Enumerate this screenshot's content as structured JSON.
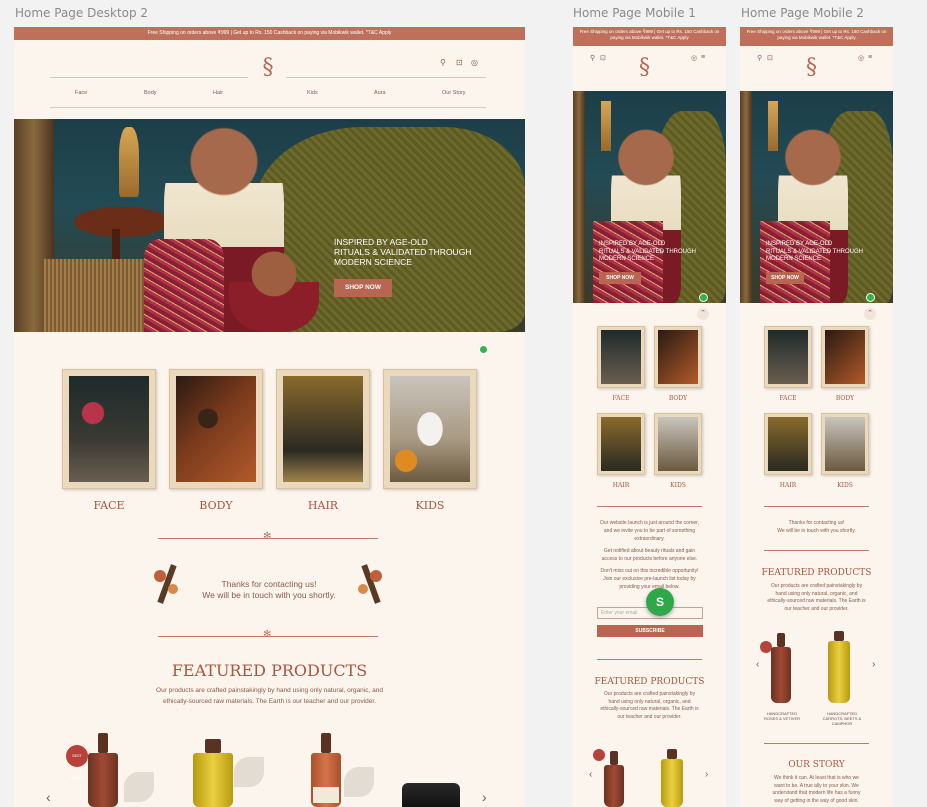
{
  "labels": {
    "desktop": "Home Page Desktop 2",
    "mobile1": "Home Page Mobile 1",
    "mobile2": "Home Page Mobile 2"
  },
  "promo": {
    "desktop": "Free Shipping on orders above ₹999 | Get up to Rs. 150 Cashback on paying via Mobikwik wallet. *T&C Apply",
    "mobile": "Free Shipping on orders above ₹999 | Get up to Rs. 150 Cashback on paying via Mobikwik wallet. *T&C Apply"
  },
  "nav": [
    "Face",
    "Body",
    "Hair",
    "Kids",
    "Aura",
    "Our Story"
  ],
  "hero": {
    "headline_line1": "INSPIRED BY AGE-OLD",
    "headline_line2": "RITUALS & VALIDATED THROUGH",
    "headline_line3": "MODERN SCIENCE",
    "cta": "SHOP NOW"
  },
  "categories": [
    "FACE",
    "BODY",
    "HAIR",
    "KIDS"
  ],
  "thanks": {
    "line1": "Thanks for contacting us!",
    "line2": "We will be in touch with you shortly.",
    "mobile_line1": "Thanks for contacting us!",
    "mobile_line2": "We will be in touch with you shortly."
  },
  "featured": {
    "title": "FEATURED PRODUCTS",
    "desc_line1": "Our products are crafted painstakingly by hand using only natural, organic, and",
    "desc_line2": "ethically-sourced raw materials. The Earth is our teacher and our provider.",
    "mobile_desc1": "Our products are crafted painstakingly by",
    "mobile_desc2": "hand using only natural, organic, and",
    "mobile_desc3": "ethically-sourced raw materials. The Earth is",
    "mobile_desc4": "our teacher and our provider.",
    "best_seller": "BEST SELLER"
  },
  "newsletter": {
    "line1": "Our website launch is just around the corner,",
    "line2": "and we invite you to be part of something",
    "line3": "extraordinary.",
    "line4": "Get notified about beauty rituals and gain",
    "line5": "access to our products before anyone else.",
    "line6": "Don't miss out on this incredible opportunity!",
    "line7": "Join our exclusive pre-launch list today by",
    "line8": "providing your email below.",
    "placeholder": "Enter your email",
    "subscribe": "SUBSCRIBE"
  },
  "mobile_products": [
    {
      "name_line1": "HANDCRAFTED",
      "name_line2": "ROSES & VETIVER"
    },
    {
      "name_line1": "HANDCRAFTED",
      "name_line2": "CARROTS, BEETS & CAMPHOR"
    }
  ],
  "our_story": {
    "title": "OUR STORY",
    "line1": "We think it can. At least that is who we",
    "line2": "want to be. A true ally to your skin. We",
    "line3": "understand that modern life has a funny",
    "line4": "way of getting in the way of good skin."
  },
  "float_badge": "S",
  "colors": {
    "promo": "#c0705a",
    "accent": "#a8563d",
    "page": "#fbf5ee",
    "button": "#b86552",
    "whatsapp": "#2fb34a"
  }
}
